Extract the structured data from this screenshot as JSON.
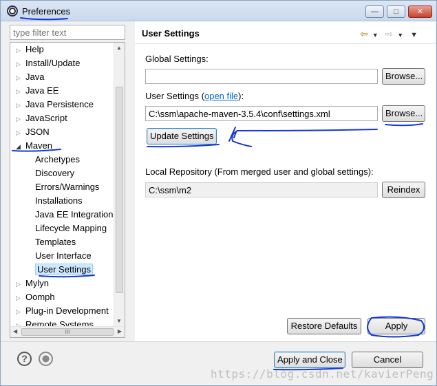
{
  "window": {
    "title": "Preferences",
    "min_glyph": "—",
    "max_glyph": "□",
    "close_glyph": "✕"
  },
  "sidebar": {
    "filter_placeholder": "type filter text",
    "items": [
      {
        "label": "Help",
        "level": 0,
        "expanded": false
      },
      {
        "label": "Install/Update",
        "level": 0,
        "expanded": false
      },
      {
        "label": "Java",
        "level": 0,
        "expanded": false
      },
      {
        "label": "Java EE",
        "level": 0,
        "expanded": false
      },
      {
        "label": "Java Persistence",
        "level": 0,
        "expanded": false
      },
      {
        "label": "JavaScript",
        "level": 0,
        "expanded": false
      },
      {
        "label": "JSON",
        "level": 0,
        "expanded": false
      },
      {
        "label": "Maven",
        "level": 0,
        "expanded": true
      },
      {
        "label": "Archetypes",
        "level": 1
      },
      {
        "label": "Discovery",
        "level": 1
      },
      {
        "label": "Errors/Warnings",
        "level": 1
      },
      {
        "label": "Installations",
        "level": 1
      },
      {
        "label": "Java EE Integration",
        "level": 1
      },
      {
        "label": "Lifecycle Mapping",
        "level": 1
      },
      {
        "label": "Templates",
        "level": 1
      },
      {
        "label": "User Interface",
        "level": 1
      },
      {
        "label": "User Settings",
        "level": 1,
        "selected": true
      },
      {
        "label": "Mylyn",
        "level": 0,
        "expanded": false
      },
      {
        "label": "Oomph",
        "level": 0,
        "expanded": false
      },
      {
        "label": "Plug-in Development",
        "level": 0,
        "expanded": false
      },
      {
        "label": "Remote Systems",
        "level": 0,
        "expanded": false
      }
    ],
    "hscroll_thumb": "III"
  },
  "page": {
    "title": "User Settings",
    "global_settings_label": "Global Settings:",
    "global_settings_value": "",
    "global_browse": "Browse...",
    "user_settings_label": "User Settings (",
    "user_settings_link": "open file",
    "user_settings_label_end": "):",
    "user_settings_value": "C:\\ssm\\apache-maven-3.5.4\\conf\\settings.xml",
    "user_browse": "Browse...",
    "update_settings": "Update Settings",
    "local_repo_label": "Local Repository (From merged user and global settings):",
    "local_repo_value": "C:\\ssm\\m2",
    "reindex": "Reindex",
    "restore_defaults": "Restore Defaults",
    "apply": "Apply"
  },
  "footer": {
    "help_glyph": "?",
    "apply_and_close": "Apply and Close",
    "cancel": "Cancel",
    "watermark": "https://blog.csdn.net/kavierPeng"
  },
  "colors": {
    "annotation": "#1238d8",
    "selection": "#cde8ff"
  }
}
